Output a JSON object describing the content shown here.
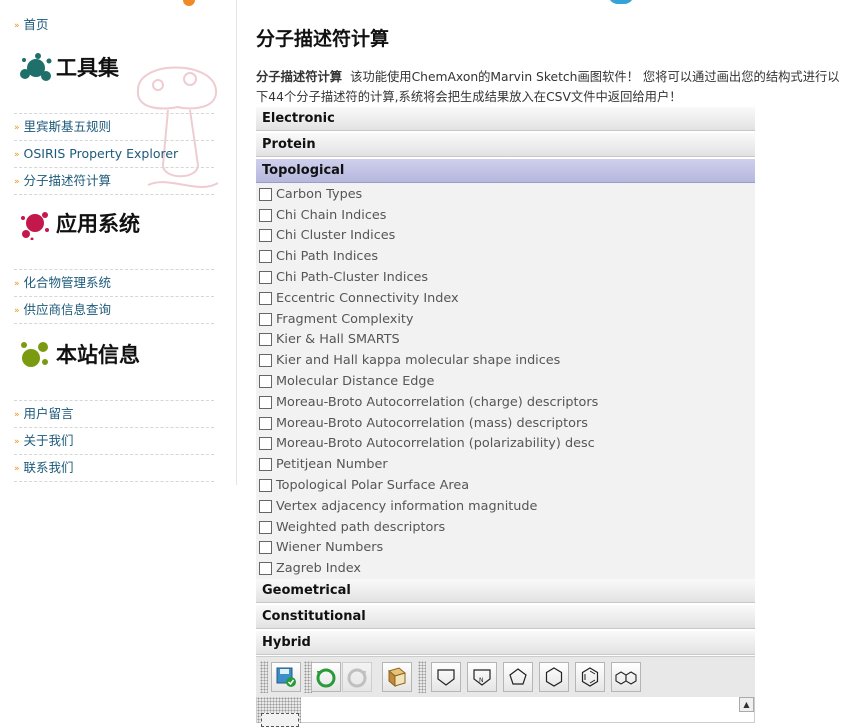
{
  "sidebar": {
    "home": "首页",
    "sections": [
      {
        "title": "工具集",
        "icon": "tools-splash-icon",
        "color": "#1f6f6a",
        "links": [
          "里宾斯基五规则",
          "OSIRIS Property Explorer",
          "分子描述符计算"
        ]
      },
      {
        "title": "应用系统",
        "icon": "apps-splash-icon",
        "color": "#c4184c",
        "links": [
          "化合物管理系统",
          "供应商信息查询"
        ]
      },
      {
        "title": "本站信息",
        "icon": "info-splash-icon",
        "color": "#7a9a10",
        "links": [
          "用户留言",
          "关于我们",
          "联系我们"
        ]
      }
    ]
  },
  "main": {
    "title": "分子描述符计算",
    "intro_bold": "分子描述符计算",
    "intro_text": "该功能使用ChemAxon的Marvin Sketch画图软件！ 您将可以通过画出您的结构式进行以下44个分子描述符的计算,系统将会把生成结果放入在CSV文件中返回给用户！",
    "categories_top": [
      "Electronic",
      "Protein",
      "Topological"
    ],
    "topological_items": [
      "Carbon Types",
      "Chi Chain Indices",
      "Chi Cluster Indices",
      "Chi Path Indices",
      "Chi Path-Cluster Indices",
      "Eccentric Connectivity Index",
      "Fragment Complexity",
      "Kier & Hall SMARTS",
      "Kier and Hall kappa molecular shape indices",
      "Molecular Distance Edge",
      "Moreau-Broto Autocorrelation (charge) descriptors",
      "Moreau-Broto Autocorrelation (mass) descriptors",
      "Moreau-Broto Autocorrelation (polarizability) desc",
      "Petitjean Number",
      "Topological Polar Surface Area",
      "Vertex adjacency information magnitude",
      "Weighted path descriptors",
      "Wiener Numbers",
      "Zagreb Index"
    ],
    "categories_bottom": [
      "Geometrical",
      "Constitutional",
      "Hybrid"
    ]
  },
  "toolbar": {
    "buttons": [
      "save-structure-icon",
      "undo-icon",
      "redo-icon",
      "template-book-icon",
      "chain-shape-icon",
      "chain-n-shape-icon",
      "pentagon-ring-icon",
      "hexagon-ring-icon",
      "benzene-ring-icon",
      "naphthalene-ring-icon"
    ]
  },
  "colors": {
    "link": "#1c5a7a",
    "bullet": "#e89a1a",
    "active_header": "#b5b7de"
  }
}
